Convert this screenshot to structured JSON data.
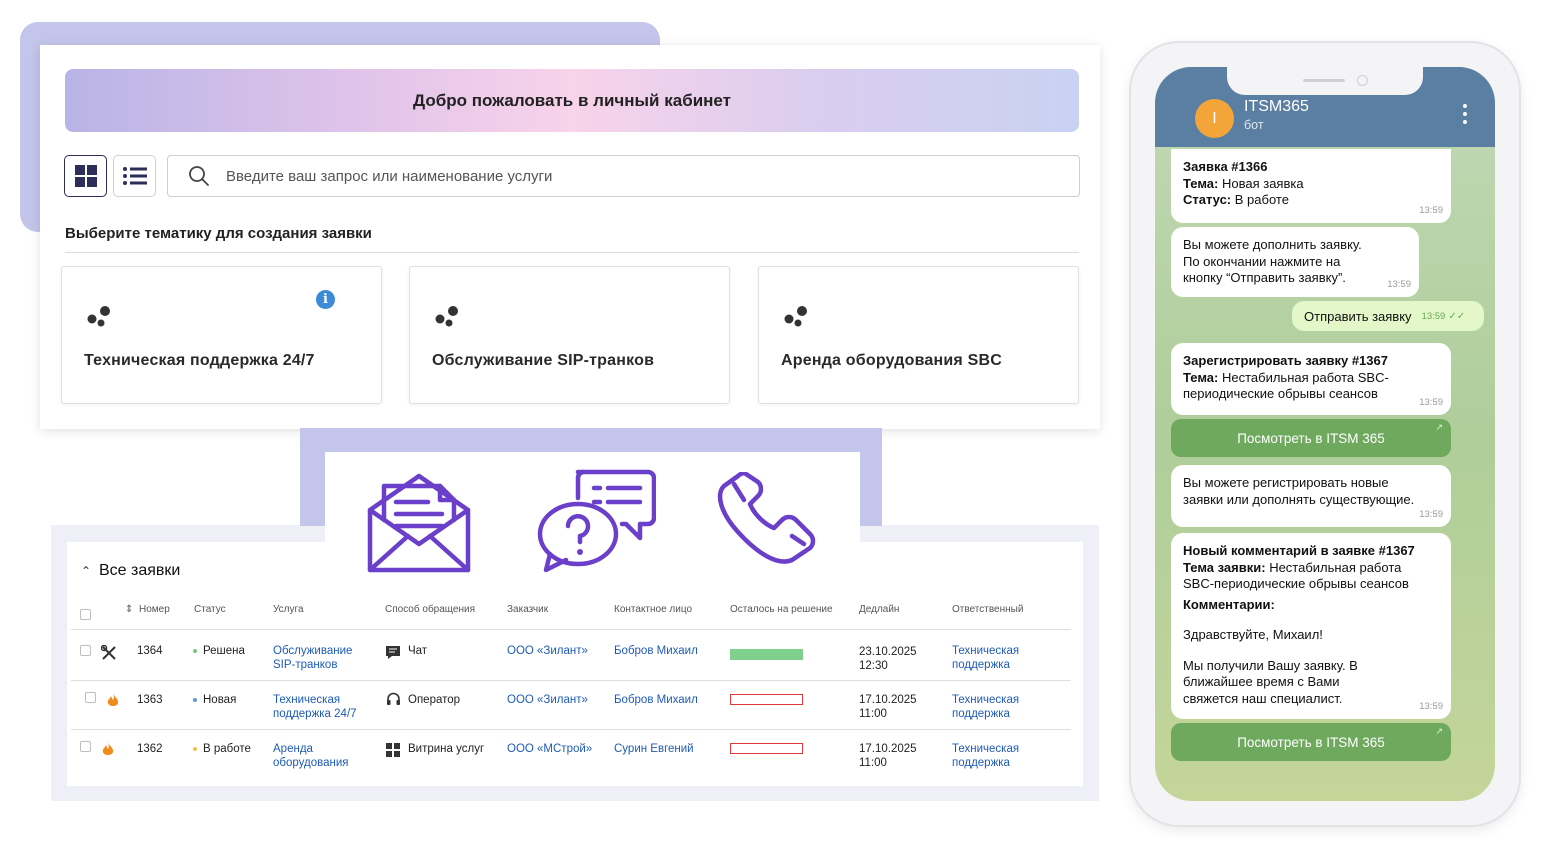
{
  "portal": {
    "banner": "Добро пожаловать в личный кабинет",
    "search_placeholder": "Введите ваш запрос или наименование услуги",
    "section_title": "Выберите тематику для создания заявки",
    "services": [
      {
        "label": "Техническая поддержка 24/7"
      },
      {
        "label": "Обслуживание SIP-транков"
      },
      {
        "label": "Аренда оборудования SBC"
      }
    ]
  },
  "tickets": {
    "title": "Все заявки",
    "columns": [
      "Номер",
      "Статус",
      "Услуга",
      "Способ обращения",
      "Заказчик",
      "Контактное лицо",
      "Осталось на решение",
      "Дедлайн",
      "Ответственный"
    ],
    "rows": [
      {
        "number": "1364",
        "status": "Решена",
        "status_color": "#7bc67b",
        "service_1": "Обслуживание",
        "service_2": "SIP-транков",
        "channel": "Чат",
        "customer": "ООО «Зилант»",
        "contact": "Бобров Михаил",
        "remaining_fraction": 1.0,
        "deadline_date": "23.10.2025",
        "deadline_time": "12:30",
        "owner_1": "Техническая",
        "owner_2": "поддержка"
      },
      {
        "number": "1363",
        "status": "Новая",
        "status_color": "#5a9be0",
        "service_1": "Техническая",
        "service_2": "поддержка 24/7",
        "channel": "Оператор",
        "customer": "ООО «Зилант»",
        "contact": "Бобров Михаил",
        "remaining_fraction": 0,
        "deadline_date": "17.10.2025",
        "deadline_time": "11:00",
        "owner_1": "Техническая",
        "owner_2": "поддержка"
      },
      {
        "number": "1362",
        "status": "В работе",
        "status_color": "#f0c040",
        "service_1": "Аренда",
        "service_2": "оборудования",
        "channel": "Витрина услуг",
        "customer": "ООО «МСтрой»",
        "contact": "Сурин Евгений",
        "remaining_fraction": 0,
        "deadline_date": "17.10.2025",
        "deadline_time": "11:00",
        "owner_1": "Техническая",
        "owner_2": "поддержка"
      }
    ]
  },
  "chat": {
    "avatar_letter": "I",
    "name": "ITSM365",
    "subtitle": "бот",
    "msg1": {
      "l1": "Заявка #1366",
      "k2": "Тема:",
      "v2": " Новая заявка",
      "k3": "Статус:",
      "v3": " В работе",
      "time": "13:59"
    },
    "msg2": {
      "l1": "Вы можете дополнить заявку.",
      "l2": "По окончании нажмите на",
      "l3": "кнопку “Отправить заявку”.",
      "time": "13:59"
    },
    "out": {
      "text": "Отправить заявку",
      "time": "13:59"
    },
    "msg3": {
      "l1": "Зарегистрировать заявку #1367",
      "k2": "Тема:",
      "v2": " Нестабильная работа SBC-",
      "l3": "периодические обрывы сеансов",
      "time": "13:59"
    },
    "button1": "Посмотреть в ITSM 365",
    "msg4": {
      "l1": "Вы можете регистрировать новые",
      "l2": "заявки или дополнять существующие.",
      "time": "13:59"
    },
    "msg5": {
      "l1": "Новый комментарий в заявке #1367",
      "k2": "Тема заявки:",
      "v2": " Нестабильная работа",
      "l3": "SBC-периодические обрывы сеансов",
      "l4": "Комментарии:",
      "l5": "Здравствуйте, Михаил!",
      "l6": "Мы получили Вашу заявку. В",
      "l7": "ближайшее время с Вами",
      "l8": "свяжется наш специалист.",
      "time": "13:59"
    },
    "button2": "Посмотреть в ITSM 365"
  },
  "colors": {
    "accent_purple": "#6a3fc9",
    "link_blue": "#1e5bb8",
    "progress_green": "#7fcf8d",
    "progress_red": "#e03a3a",
    "tg_header": "#5b7fa3",
    "tg_button": "#6fa95d"
  }
}
